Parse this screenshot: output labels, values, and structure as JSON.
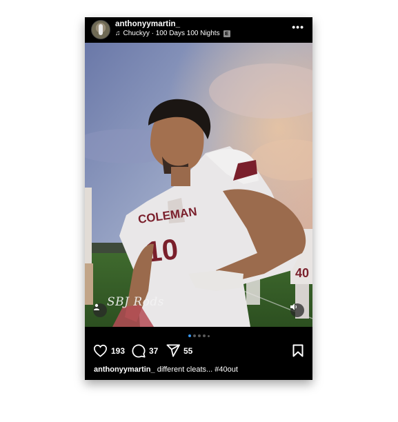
{
  "post": {
    "username": "anthonyymartin_",
    "music": {
      "track": "Chuckyy · 100 Days 100 Nights",
      "explicit_label": "E"
    },
    "image_watermark": "SBJ Rods",
    "jersey_text": "COLEMAN",
    "jersey_number": "10",
    "background_jersey_number": "40",
    "carousel": {
      "count": 5,
      "active_index": 0
    },
    "likes": "193",
    "comments": "37",
    "shares": "55",
    "caption": {
      "username": "anthonyymartin_",
      "text": "different cleats... #40out"
    }
  },
  "icons": {
    "more": "more-horizontal-icon",
    "music": "music-note-icon",
    "like": "heart-icon",
    "comment": "comment-icon",
    "share": "send-icon",
    "save": "bookmark-icon",
    "tag": "user-tag-icon",
    "sound": "speaker-icon"
  },
  "colors": {
    "background": "#000000",
    "text": "#ffffff",
    "active_dot": "#3897f0",
    "jersey_maroon": "#7a1f2b"
  }
}
